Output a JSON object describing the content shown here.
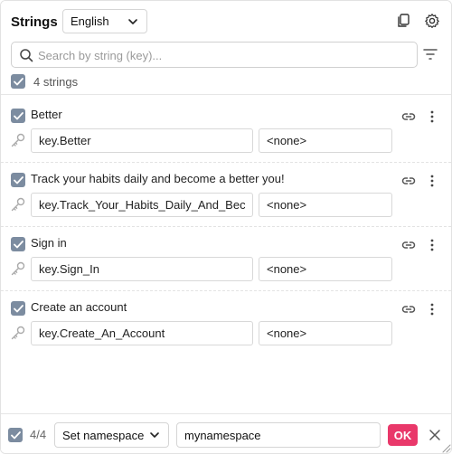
{
  "header": {
    "title": "Strings",
    "language": "English",
    "copy_icon": "copy-icon",
    "settings_icon": "gear-icon"
  },
  "search": {
    "placeholder": "Search by string (key)...",
    "value": ""
  },
  "summary": {
    "count_label": "4 strings"
  },
  "strings": [
    {
      "text": "Better",
      "key": "key.Better",
      "namespace": "<none>"
    },
    {
      "text": "Track your habits daily and become a better you!",
      "key": "key.Track_Your_Habits_Daily_And_Become_A_Better_You",
      "namespace": "<none>"
    },
    {
      "text": "Sign in",
      "key": "key.Sign_In",
      "namespace": "<none>"
    },
    {
      "text": "Create an account",
      "key": "key.Create_An_Account",
      "namespace": "<none>"
    }
  ],
  "footer": {
    "selected_count": "4/4",
    "action": "Set namespace",
    "namespace_value": "mynamespace",
    "ok_label": "OK"
  },
  "colors": {
    "accent": "#e9386a",
    "checkbox": "#7c8ca0"
  }
}
